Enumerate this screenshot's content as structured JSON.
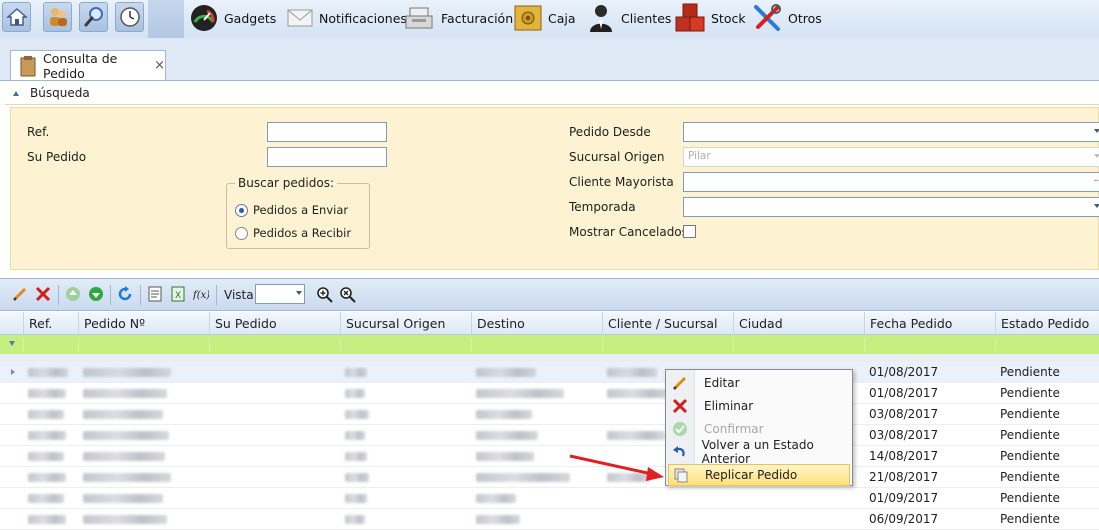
{
  "colors": {
    "accent": "#3c6eb4",
    "filter_row": "#c6ef82",
    "search_bg": "#fdf3d2",
    "arrow": "#e02020"
  },
  "topbar": {
    "quick_icons": [
      "home-icon",
      "users-icon",
      "search-icon",
      "clock-icon"
    ],
    "menu": [
      {
        "label": "Gadgets",
        "icon": "gauge-icon"
      },
      {
        "label": "Notificaciones",
        "icon": "envelope-icon"
      },
      {
        "label": "Facturación",
        "icon": "cash-register-icon"
      },
      {
        "label": "Caja",
        "icon": "safe-icon"
      },
      {
        "label": "Clientes",
        "icon": "client-icon"
      },
      {
        "label": "Stock",
        "icon": "boxes-icon"
      },
      {
        "label": "Otros",
        "icon": "tools-icon"
      }
    ]
  },
  "tab": {
    "label": "Consulta de Pedido",
    "close": "×"
  },
  "search": {
    "header": "Búsqueda",
    "ref_label": "Ref.",
    "su_pedido_label": "Su Pedido",
    "group_label": "Buscar pedidos:",
    "radio_enviar": "Pedidos a Enviar",
    "radio_recibir": "Pedidos a Recibir",
    "radio_selected": "Pedidos a Enviar",
    "pedido_desde_label": "Pedido Desde",
    "sucursal_origen_label": "Sucursal Origen",
    "sucursal_origen_value": "Pilar",
    "cliente_mayorista_label": "Cliente Mayorista",
    "cliente_mayorista_btn": "...",
    "temporada_label": "Temporada",
    "mostrar_cancelados_label": "Mostrar Cancelados",
    "mostrar_cancelados_checked": false
  },
  "gridtoolbar": {
    "vista_label": "Vista",
    "vista_value": ""
  },
  "grid": {
    "columns": [
      "Ref.",
      "Pedido Nº",
      "Su Pedido",
      "Sucursal Origen",
      "Destino",
      "Cliente / Sucursal",
      "Ciudad",
      "Fecha Pedido",
      "Estado Pedido"
    ],
    "rows": [
      {
        "fecha": "01/08/2017",
        "estado": "Pendiente"
      },
      {
        "fecha": "01/08/2017",
        "estado": "Pendiente"
      },
      {
        "fecha": "03/08/2017",
        "estado": "Pendiente"
      },
      {
        "fecha": "03/08/2017",
        "estado": "Pendiente"
      },
      {
        "fecha": "14/08/2017",
        "estado": "Pendiente"
      },
      {
        "fecha": "21/08/2017",
        "estado": "Pendiente"
      },
      {
        "fecha": "01/09/2017",
        "estado": "Pendiente"
      },
      {
        "fecha": "06/09/2017",
        "estado": "Pendiente"
      }
    ]
  },
  "context_menu": {
    "items": [
      {
        "label": "Editar",
        "icon": "pencil-icon",
        "enabled": true
      },
      {
        "label": "Eliminar",
        "icon": "delete-x-icon",
        "enabled": true
      },
      {
        "label": "Confirmar",
        "icon": "check-icon",
        "enabled": false
      },
      {
        "label": "Volver a un Estado Anterior",
        "icon": "undo-icon",
        "enabled": true
      },
      {
        "label": "Replicar Pedido",
        "icon": "replicate-icon",
        "enabled": true,
        "highlighted": true
      }
    ]
  }
}
